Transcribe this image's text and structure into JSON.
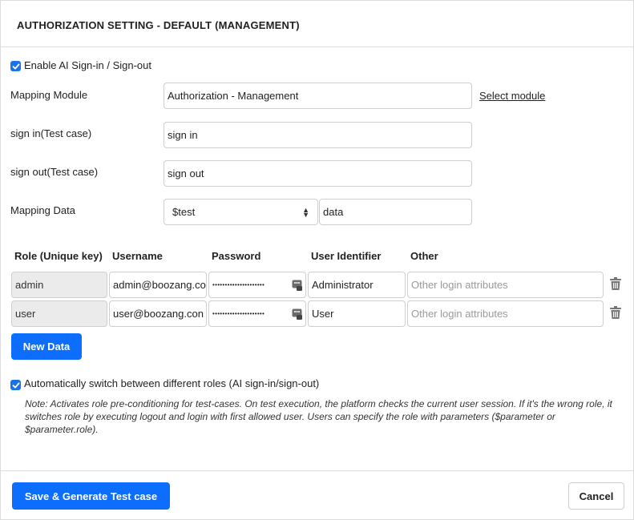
{
  "header": {
    "title": "AUTHORIZATION SETTING - DEFAULT (MANAGEMENT)"
  },
  "enable_ai": {
    "label": "Enable AI Sign-in / Sign-out",
    "checked": true
  },
  "mapping_module": {
    "label": "Mapping Module",
    "value": "Authorization - Management",
    "link": "Select module"
  },
  "sign_in": {
    "label": "sign in(Test case)",
    "value": "sign in"
  },
  "sign_out": {
    "label": "sign out(Test case)",
    "value": "sign out"
  },
  "mapping_data": {
    "label": "Mapping Data",
    "select_value": "$test",
    "value": "data"
  },
  "table": {
    "headers": [
      "Role (Unique key)",
      "Username",
      "Password",
      "User Identifier",
      "Other"
    ],
    "rows": [
      {
        "role": "admin",
        "username": "admin@boozang.co",
        "password": "•••••••••••••••••••••",
        "identifier": "Administrator",
        "other_placeholder": "Other login attributes"
      },
      {
        "role": "user",
        "username": "user@boozang.con",
        "password": "•••••••••••••••••••••",
        "identifier": "User",
        "other_placeholder": "Other login attributes"
      }
    ]
  },
  "new_data_button": "New Data",
  "auto_switch": {
    "label": "Automatically switch between different roles (AI sign-in/sign-out)",
    "checked": true
  },
  "note": "Note: Activates role pre-conditioning for test-cases. On test execution, the platform checks the current user session. If it's the wrong role, it switches role by executing logout and login with first allowed user. Users can specify the role with parameters ($parameter or $parameter.role).",
  "footer": {
    "save_button": "Save & Generate Test case",
    "cancel_button": "Cancel"
  },
  "colors": {
    "primary": "#0d6efd",
    "checkbox": "#1a73e8",
    "border": "#cfcfcf",
    "readonly_bg": "#ebebeb"
  },
  "icons": {
    "checkbox": "checkmark-icon",
    "password_manager": "password-key-icon",
    "delete": "trash-icon",
    "select": "select-arrows-icon"
  }
}
